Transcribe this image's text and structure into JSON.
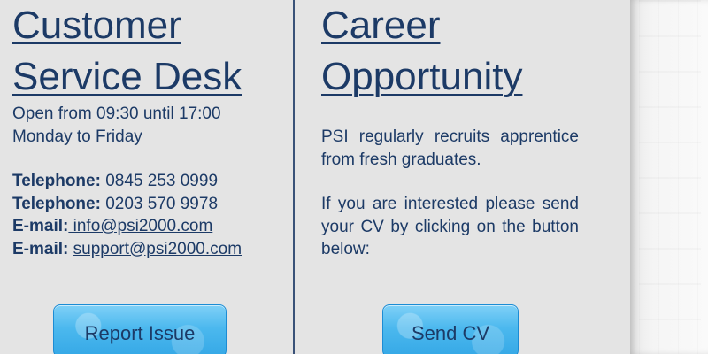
{
  "customer_service": {
    "title_line1": "Customer",
    "title_line2": "Service Desk",
    "hours_line1": "Open from 09:30 until 17:00",
    "hours_line2": "Monday to Friday",
    "contacts": [
      {
        "label": "Telephone:",
        "value": " 0845 253 0999"
      },
      {
        "label": "Telephone:",
        "value": " 0203 570 9978"
      },
      {
        "label": "E-mail:",
        "value": " info@psi2000.com"
      },
      {
        "label": "E-mail:",
        "value": "support@psi2000.com"
      }
    ],
    "button_label": "Report Issue"
  },
  "career": {
    "title_line1": "Career",
    "title_line2": "Opportunity",
    "paragraph1": "PSI regularly recruits apprentice from fresh graduates.",
    "paragraph2": "If you are interested please send your CV by clicking on the button below:",
    "button_label": "Send CV"
  },
  "colors": {
    "text": "#1c3a66",
    "panel": "#e4e4e4",
    "button": "#4bb8ee",
    "divider": "#3a5278"
  }
}
